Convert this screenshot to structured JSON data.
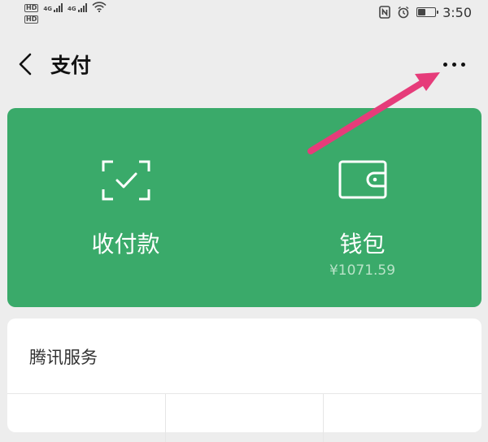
{
  "status_bar": {
    "left_sims": [
      {
        "hd": "HD",
        "net": "4G"
      },
      {
        "hd": "HD",
        "net": "4G"
      }
    ],
    "time": "3:50",
    "battery_level": 0.45,
    "icons": [
      "nfc-icon",
      "alarm-icon",
      "battery-icon",
      "wifi-icon",
      "signal-icon"
    ]
  },
  "header": {
    "title": "支付"
  },
  "pay_card": {
    "color": "#3aaa6a",
    "receive": {
      "label": "收付款"
    },
    "wallet": {
      "label": "钱包",
      "balance": "¥1071.59"
    },
    "balance_color": "#b9e3c8"
  },
  "services": {
    "title": "腾讯服务"
  },
  "annotation": {
    "arrow_color": "#e63c7a"
  }
}
